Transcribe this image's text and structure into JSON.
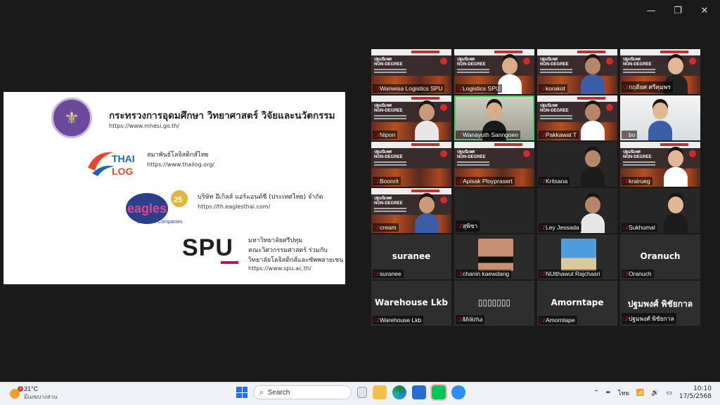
{
  "window": {
    "minimize": "—",
    "restore": "❐",
    "close": "✕"
  },
  "slide": {
    "mhesi_title": "กระทรวงการอุดมศึกษา วิทยาศาสตร์ วิจัยและนวัตกรรม",
    "mhesi_url": "https://www.mhesi.go.th/",
    "thailog_logo_top": "THAI",
    "thailog_logo_bottom": "LOG",
    "thailog_name": "สมาพันธ์โลจิสติกส์ไทย",
    "thailog_url": "https://www.thailog.org/",
    "eagles_logo": "eagles",
    "eagles_logo_sub": "Group of Companies",
    "eagles_badge": "25",
    "eagles_name": "บริษัท อีเกิลส์ แอร์แอนด์ซี (ประเทศไทย) จำกัด",
    "eagles_url": "https://th.eaglesthai.com/",
    "spu_logo": "SPU",
    "spu_line1": "มหาวิทยาลัยศรีปทุม",
    "spu_line2": "คณะวิศวกรรมศาสตร์ ร่วมกับ",
    "spu_line3": "วิทยาลัยโลจิสติกส์และซัพพลายเชน",
    "spu_url": "https://www.spu.ac.th/"
  },
  "participants": [
    {
      "name": "Wanwisa Logistics SPU",
      "type": "poster"
    },
    {
      "name": "Logistics SPU",
      "type": "poster-person"
    },
    {
      "name": "korakot",
      "type": "poster-person"
    },
    {
      "name": "กฤติยศ ศรีคุมพร",
      "type": "poster-person"
    },
    {
      "name": "Nipon",
      "type": "poster-person"
    },
    {
      "name": "Wanayuth Sanngoen",
      "type": "camera",
      "active": true
    },
    {
      "name": "Pakkawat T",
      "type": "poster-person"
    },
    {
      "name": "bo",
      "type": "camera"
    },
    {
      "name": "Boonrit",
      "type": "poster"
    },
    {
      "name": "Apisak Ployprasert",
      "type": "poster"
    },
    {
      "name": "Kritsana",
      "type": "dark-person"
    },
    {
      "name": "krairueg",
      "type": "poster-person"
    },
    {
      "name": "cream",
      "type": "poster-person"
    },
    {
      "name": "สุพิชา",
      "type": "dark"
    },
    {
      "name": "Ley Jessada",
      "type": "dark-person"
    },
    {
      "name": "Sukhumal",
      "type": "dark-person"
    },
    {
      "name": "suranee",
      "type": "text",
      "big": "suranee"
    },
    {
      "name": "chanin kaewdang",
      "type": "photo"
    },
    {
      "name": "NUtthawut Rajchasri",
      "type": "photo2"
    },
    {
      "name": "Oranuch",
      "type": "text",
      "big": "Oranuch"
    },
    {
      "name": "Warehouse Lkb",
      "type": "text",
      "big": "Warehouse Lkb"
    },
    {
      "name": "𝑀𝑖𝑙𝑘𝑡ℎ𝑎",
      "type": "text",
      "big": "▯▯▯▯▯▯▯"
    },
    {
      "name": "Amorntape",
      "type": "text",
      "big": "Amorntape"
    },
    {
      "name": "ปฐมพงศ์ พิชัยกาล",
      "type": "text",
      "big": "ปฐมพงศ์ พิชัยกาล"
    }
  ],
  "poster": {
    "title_l1": "ปฐมนิเทศ",
    "title_l2": "NON-DEGREE"
  },
  "taskbar": {
    "temperature": "31°C",
    "weather_desc": "มีเมฆบางส่วน",
    "weather_badge": "1",
    "search_label": "Search",
    "language": "ไทย",
    "time": "10:10",
    "date": "17/5/2568"
  }
}
